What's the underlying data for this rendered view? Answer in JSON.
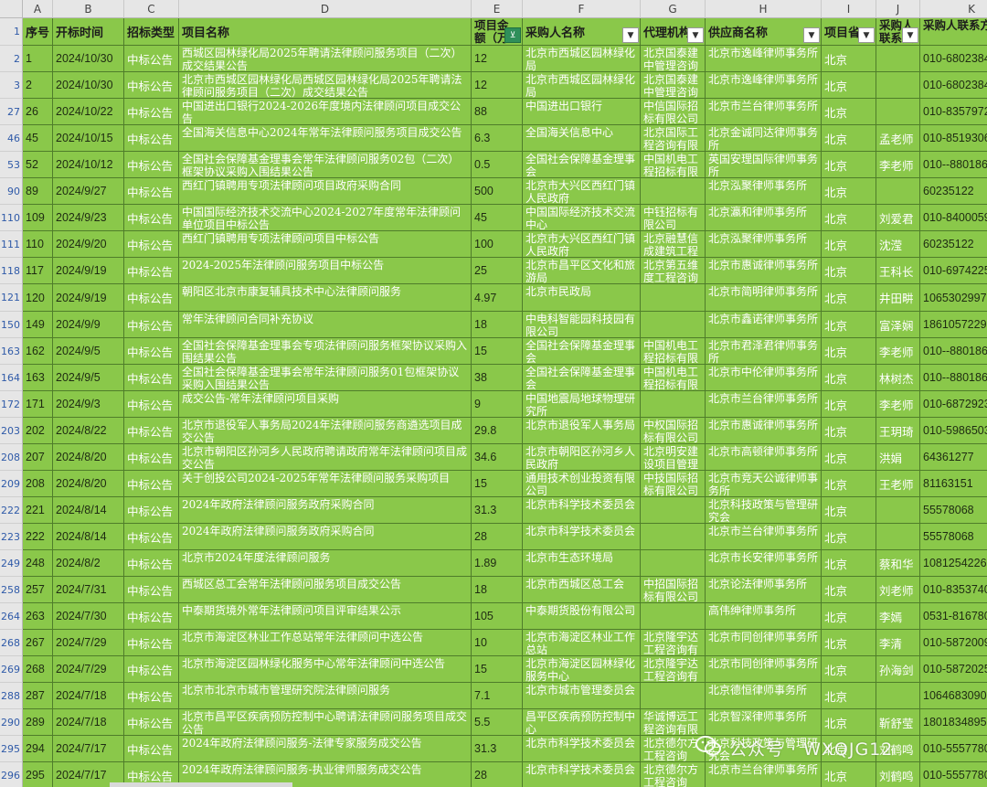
{
  "columns": [
    "A",
    "B",
    "C",
    "D",
    "E",
    "F",
    "G",
    "H",
    "I",
    "J",
    "K"
  ],
  "headers": {
    "seq": "序号",
    "open_time": "开标时间",
    "bid_type": "招标类型",
    "project_name": "项目名称",
    "amount": "项目金额（万",
    "purchaser": "采购人名称",
    "agency": "代理机构",
    "supplier": "供应商名称",
    "province": "项目省",
    "contact": "采购人联系人",
    "phone": "采购人联系方式"
  },
  "header_row_number": "1",
  "rows": [
    {
      "rn": "2",
      "seq": "1",
      "date": "2024/10/30",
      "type": "中标公告",
      "name": "西城区园林绿化局2025年聘请法律顾问服务项目（二次）成交结果公告",
      "amount": "12",
      "purchaser": "北京市西城区园林绿化局",
      "agency": "北京国泰建中管理咨询",
      "supplier": "北京市逸峰律师事务所",
      "prov": "北京",
      "contact": "",
      "phone": "010-6802384"
    },
    {
      "rn": "3",
      "seq": "2",
      "date": "2024/10/30",
      "type": "中标公告",
      "name": "北京市西城区园林绿化局西城区园林绿化局2025年聘请法律顾问服务项目（二次）成交结果公告",
      "amount": "12",
      "purchaser": "北京市西城区园林绿化局",
      "agency": "北京国泰建中管理咨询",
      "supplier": "北京市逸峰律师事务所",
      "prov": "北京",
      "contact": "",
      "phone": "010-6802384"
    },
    {
      "rn": "27",
      "seq": "26",
      "date": "2024/10/22",
      "type": "中标公告",
      "name": "中国进出口银行2024-2026年度境内法律顾问项目成交公告",
      "amount": "88",
      "purchaser": "中国进出口银行",
      "agency": "中信国际招标有限公司",
      "supplier": "北京市兰台律师事务所",
      "prov": "北京",
      "contact": "",
      "phone": "010-8357972"
    },
    {
      "rn": "46",
      "seq": "45",
      "date": "2024/10/15",
      "type": "中标公告",
      "name": "全国海关信息中心2024年常年法律顾问服务项目成交公告",
      "amount": "6.3",
      "purchaser": "全国海关信息中心",
      "agency": "北京国际工程咨询有限",
      "supplier": "北京金诚同达律师事务所",
      "prov": "北京",
      "contact": "孟老师",
      "phone": "010-8519306"
    },
    {
      "rn": "53",
      "seq": "52",
      "date": "2024/10/12",
      "type": "中标公告",
      "name": "全国社会保障基金理事会常年法律顾问服务02包（二次）框架协议采购入围结果公告",
      "amount": "0.5",
      "purchaser": "全国社会保障基金理事会",
      "agency": "中国机电工程招标有限",
      "supplier": "英国安理国际律师事务所",
      "prov": "北京",
      "contact": "李老师",
      "phone": "010--880186"
    },
    {
      "rn": "90",
      "seq": "89",
      "date": "2024/9/27",
      "type": "中标公告",
      "name": "西红门镇聘用专项法律顾问项目政府采购合同",
      "amount": "500",
      "purchaser": "北京市大兴区西红门镇人民政府",
      "agency": "",
      "supplier": "北京泓聚律师事务所",
      "prov": "北京",
      "contact": "",
      "phone": "60235122"
    },
    {
      "rn": "110",
      "seq": "109",
      "date": "2024/9/23",
      "type": "中标公告",
      "name": "中国国际经济技术交流中心2024-2027年度常年法律顾问单位项目中标公告",
      "amount": "45",
      "purchaser": "中国国际经济技术交流中心",
      "agency": "中钰招标有限公司",
      "supplier": "北京瀛和律师事务所",
      "prov": "北京",
      "contact": "刘爱君",
      "phone": "010-8400059"
    },
    {
      "rn": "111",
      "seq": "110",
      "date": "2024/9/20",
      "type": "中标公告",
      "name": "西红门镇聘用专项法律顾问项目中标公告",
      "amount": "100",
      "purchaser": "北京市大兴区西红门镇人民政府",
      "agency": "北京融慧信成建筑工程",
      "supplier": "北京泓聚律师事务所",
      "prov": "北京",
      "contact": "沈滢",
      "phone": "60235122"
    },
    {
      "rn": "118",
      "seq": "117",
      "date": "2024/9/19",
      "type": "中标公告",
      "name": "2024-2025年法律顾问服务项目中标公告",
      "amount": "25",
      "purchaser": "北京市昌平区文化和旅游局",
      "agency": "北京第五维度工程咨询",
      "supplier": "北京市惠诚律师事务所",
      "prov": "北京",
      "contact": "王科长",
      "phone": "010-6974225"
    },
    {
      "rn": "121",
      "seq": "120",
      "date": "2024/9/19",
      "type": "中标公告",
      "name": "朝阳区北京市康复辅具技术中心法律顾问服务",
      "amount": "4.97",
      "purchaser": "北京市民政局",
      "agency": "",
      "supplier": "北京市简明律师事务所",
      "prov": "北京",
      "contact": "井田畊",
      "phone": "1065302997"
    },
    {
      "rn": "150",
      "seq": "149",
      "date": "2024/9/9",
      "type": "中标公告",
      "name": "常年法律顾问合同补充协议",
      "amount": "18",
      "purchaser": "中电科智能园科技园有限公司",
      "agency": "",
      "supplier": "北京市鑫诺律师事务所",
      "prov": "北京",
      "contact": "富泽娴",
      "phone": "1861057229"
    },
    {
      "rn": "163",
      "seq": "162",
      "date": "2024/9/5",
      "type": "中标公告",
      "name": "全国社会保障基金理事会专项法律顾问服务框架协议采购入围结果公告",
      "amount": "15",
      "purchaser": "全国社会保障基金理事会",
      "agency": "中国机电工程招标有限",
      "supplier": "北京市君泽君律师事务所",
      "prov": "北京",
      "contact": "李老师",
      "phone": "010--880186"
    },
    {
      "rn": "164",
      "seq": "163",
      "date": "2024/9/5",
      "type": "中标公告",
      "name": "全国社会保障基金理事会常年法律顾问服务01包框架协议采购入围结果公告",
      "amount": "38",
      "purchaser": "全国社会保障基金理事会",
      "agency": "中国机电工程招标有限",
      "supplier": "北京市中伦律师事务所",
      "prov": "北京",
      "contact": "林树杰",
      "phone": "010--880186"
    },
    {
      "rn": "172",
      "seq": "171",
      "date": "2024/9/3",
      "type": "中标公告",
      "name": "成交公告-常年法律顾问项目采购",
      "amount": "9",
      "purchaser": "中国地震局地球物理研究所",
      "agency": "",
      "supplier": "北京市兰台律师事务所",
      "prov": "北京",
      "contact": "李老师",
      "phone": "010-6872923"
    },
    {
      "rn": "203",
      "seq": "202",
      "date": "2024/8/22",
      "type": "中标公告",
      "name": "北京市退役军人事务局2024年法律顾问服务商遴选项目成交公告",
      "amount": "29.8",
      "purchaser": "北京市退役军人事务局",
      "agency": "中权国际招标有限公司",
      "supplier": "北京市惠诚律师事务所",
      "prov": "北京",
      "contact": "王玥琦",
      "phone": "010-5986503"
    },
    {
      "rn": "208",
      "seq": "207",
      "date": "2024/8/20",
      "type": "中标公告",
      "name": "北京市朝阳区孙河乡人民政府聘请政府常年法律顾问项目成交公告",
      "amount": "34.6",
      "purchaser": "北京市朝阳区孙河乡人民政府",
      "agency": "北京明安建设项目管理",
      "supplier": "北京市高顿律师事务所",
      "prov": "北京",
      "contact": "洪娟",
      "phone": "64361277"
    },
    {
      "rn": "209",
      "seq": "208",
      "date": "2024/8/20",
      "type": "中标公告",
      "name": "关于创投公司2024-2025年常年法律顾问服务采购项目",
      "amount": "15",
      "purchaser": "通用技术创业投资有限公司",
      "agency": "中技国际招标有限公司",
      "supplier": "北京市竞天公诚律师事务所",
      "prov": "北京",
      "contact": "王老师",
      "phone": "81163151"
    },
    {
      "rn": "222",
      "seq": "221",
      "date": "2024/8/14",
      "type": "中标公告",
      "name": "2024年政府法律顾问服务政府采购合同",
      "amount": "31.3",
      "purchaser": "北京市科学技术委员会",
      "agency": "",
      "supplier": "北京科技政策与管理研究会",
      "prov": "北京",
      "contact": "",
      "phone": "55578068"
    },
    {
      "rn": "223",
      "seq": "222",
      "date": "2024/8/14",
      "type": "中标公告",
      "name": "2024年政府法律顾问服务政府采购合同",
      "amount": "28",
      "purchaser": "北京市科学技术委员会",
      "agency": "",
      "supplier": "北京市兰台律师事务所",
      "prov": "北京",
      "contact": "",
      "phone": "55578068"
    },
    {
      "rn": "249",
      "seq": "248",
      "date": "2024/8/2",
      "type": "中标公告",
      "name": "北京市2024年度法律顾问服务",
      "amount": "1.89",
      "purchaser": "北京市生态环境局",
      "agency": "",
      "supplier": "北京市长安律师事务所",
      "prov": "北京",
      "contact": "蔡和华",
      "phone": "1081254226"
    },
    {
      "rn": "258",
      "seq": "257",
      "date": "2024/7/31",
      "type": "中标公告",
      "name": "西城区总工会常年法律顾问服务项目成交公告",
      "amount": "18",
      "purchaser": "北京市西城区总工会",
      "agency": "中招国际招标有限公司",
      "supplier": "北京论法律师事务所",
      "prov": "北京",
      "contact": "刘老师",
      "phone": "010-8353740"
    },
    {
      "rn": "264",
      "seq": "263",
      "date": "2024/7/30",
      "type": "中标公告",
      "name": "中泰期货境外常年法律顾问项目评审结果公示",
      "amount": "105",
      "purchaser": "中泰期货股份有限公司",
      "agency": "",
      "supplier": "高伟绅律师事务所",
      "prov": "北京",
      "contact": "李嫣",
      "phone": "0531-816780"
    },
    {
      "rn": "268",
      "seq": "267",
      "date": "2024/7/29",
      "type": "中标公告",
      "name": "北京市海淀区林业工作总站常年法律顾问中选公告",
      "amount": "10",
      "purchaser": "北京市海淀区林业工作总站",
      "agency": "北京隆宇达工程咨询有",
      "supplier": "北京市同创律师事务所",
      "prov": "北京",
      "contact": "李清",
      "phone": "010-5872009"
    },
    {
      "rn": "269",
      "seq": "268",
      "date": "2024/7/29",
      "type": "中标公告",
      "name": "北京市海淀区园林绿化服务中心常年法律顾问中选公告",
      "amount": "15",
      "purchaser": "北京市海淀区园林绿化服务中心",
      "agency": "北京隆宇达工程咨询有",
      "supplier": "北京市同创律师事务所",
      "prov": "北京",
      "contact": "孙海剑",
      "phone": "010-5872025"
    },
    {
      "rn": "288",
      "seq": "287",
      "date": "2024/7/18",
      "type": "中标公告",
      "name": "北京市北京市城市管理研究院法律顾问服务",
      "amount": "7.1",
      "purchaser": "北京市城市管理委员会",
      "agency": "",
      "supplier": "北京德恒律师事务所",
      "prov": "北京",
      "contact": "",
      "phone": "1064683090"
    },
    {
      "rn": "290",
      "seq": "289",
      "date": "2024/7/18",
      "type": "中标公告",
      "name": "北京市昌平区疾病预防控制中心聘请法律顾问服务项目成交公告",
      "amount": "5.5",
      "purchaser": "昌平区疾病预防控制中心",
      "agency": "华诚博远工程咨询有限",
      "supplier": "北京智深律师事务所",
      "prov": "北京",
      "contact": "靳舒莹",
      "phone": "1801834895"
    },
    {
      "rn": "295",
      "seq": "294",
      "date": "2024/7/17",
      "type": "中标公告",
      "name": "2024年政府法律顾问服务-法律专家服务成交公告",
      "amount": "31.3",
      "purchaser": "北京市科学技术委员会",
      "agency": "北京德尔方工程咨询",
      "supplier": "北京科技政策与管理研究会",
      "prov": "北京",
      "contact": "刘鹤鸣",
      "phone": "010-5557780"
    },
    {
      "rn": "296",
      "seq": "295",
      "date": "2024/7/17",
      "type": "中标公告",
      "name": "2024年政府法律顾问服务-执业律师服务成交公告",
      "amount": "28",
      "purchaser": "北京市科学技术委员会",
      "agency": "北京德尔方工程咨询",
      "supplier": "北京市兰台律师事务所",
      "prov": "北京",
      "contact": "刘鹤鸣",
      "phone": "010-5557780"
    }
  ],
  "watermark": "公众号 · WXQJG12",
  "colors": {
    "cell_green": "#8ac84a",
    "grid_dark": "#4f7d2a",
    "header_grey": "#e6e6e6",
    "rownum_blue": "#2f5aa8"
  }
}
